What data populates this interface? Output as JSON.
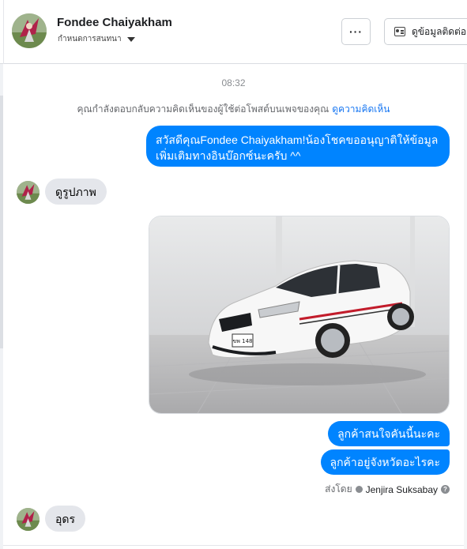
{
  "header": {
    "name": "Fondee Chaiyakham",
    "subtitle": "กำหนดการสนทนา",
    "more_label": "···",
    "contact_label": "ดูข้อมูลติดต่อ"
  },
  "thread": {
    "timestamp": "08:32",
    "notice_text": "คุณกำลังตอบกลับความคิดเห็นของผู้ใช้ต่อโพสต์บนเพจของคุณ",
    "notice_link": "ดูความคิดเห็น",
    "messages": [
      {
        "from": "page",
        "text": "สวัสดีคุณFondee Chaiyakham!น้องโชคขออนุญาติให้ข้อมูลเพิ่มเติมทางอินบ๊อกซ์นะครับ ^^"
      },
      {
        "from": "user",
        "text": "ดูรูปภาพ"
      },
      {
        "from": "page",
        "type": "image",
        "description_icon": "car-photo"
      },
      {
        "from": "page",
        "text": "ลูกค้าสนใจคันนี้นะคะ"
      },
      {
        "from": "page",
        "text": "ลูกค้าอยู่จังหวัดอะไรคะ"
      },
      {
        "from": "user",
        "text": "อุดร"
      }
    ],
    "sent_by_label": "ส่งโดย",
    "sent_by_name": "Jenjira Suksabay",
    "plate_text": "ขพ 148"
  },
  "colors": {
    "outgoing_bubble": "#0084ff",
    "incoming_bubble": "#e4e6eb",
    "link": "#1877f2"
  }
}
